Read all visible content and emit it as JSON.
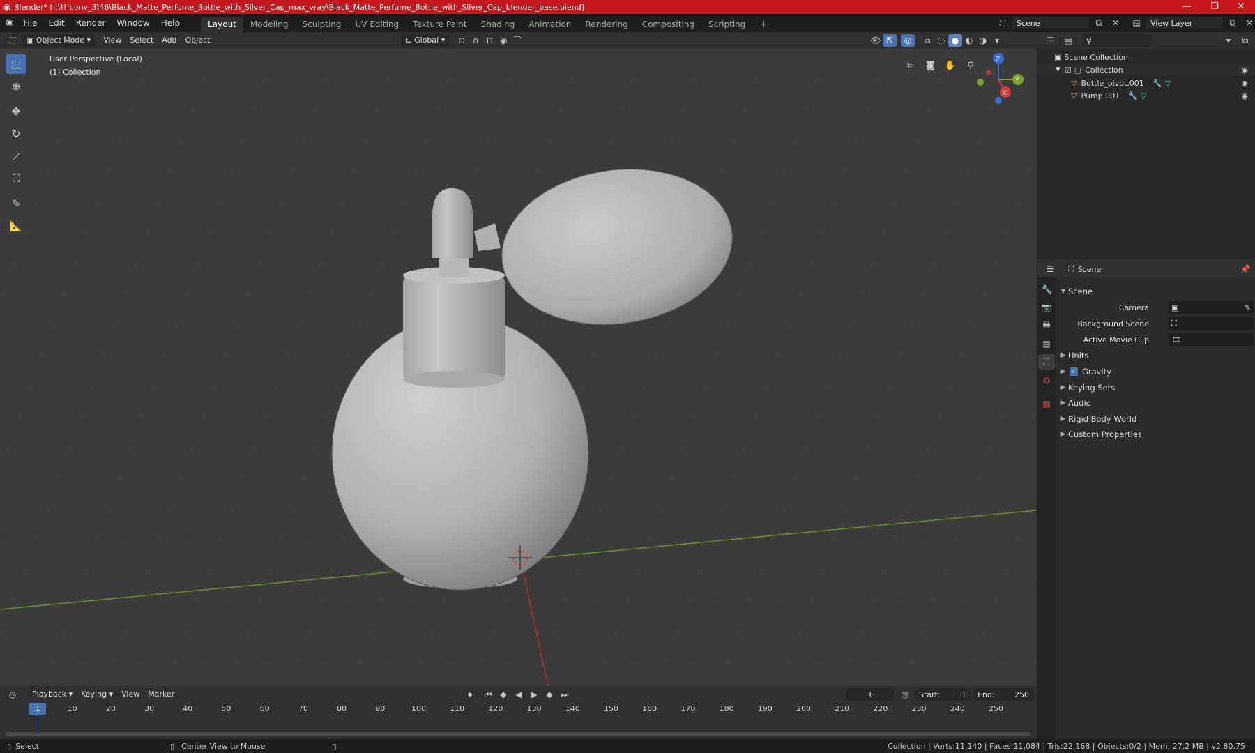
{
  "window": {
    "title": "Blender* [I:\\!!!conv_3\\46\\Black_Matte_Perfume_Bottle_with_Silver_Cap_max_vray\\Black_Matte_Perfume_Bottle_with_Silver_Cap_blender_base.blend]",
    "accent": "#c4161c"
  },
  "menu": [
    "File",
    "Edit",
    "Render",
    "Window",
    "Help"
  ],
  "workspaces": [
    "Layout",
    "Modeling",
    "Sculpting",
    "UV Editing",
    "Texture Paint",
    "Shading",
    "Animation",
    "Rendering",
    "Compositing",
    "Scripting"
  ],
  "active_workspace": "Layout",
  "scene_selector": "Scene",
  "view_layer_selector": "View Layer",
  "viewport_header": {
    "mode": "Object Mode",
    "menus": [
      "View",
      "Select",
      "Add",
      "Object"
    ],
    "orientation": "Global"
  },
  "viewport": {
    "perspective_label": "User Perspective (Local)",
    "collection_label": "(1) Collection",
    "gizmo": {
      "z": "Z",
      "y": "Y",
      "x": "X"
    }
  },
  "outliner": {
    "root": "Scene Collection",
    "collection": "Collection",
    "objects": [
      "Bottle_pivot.001",
      "Pump.001"
    ]
  },
  "properties": {
    "header": "Scene",
    "panel": "Scene",
    "fields": [
      {
        "label": "Camera"
      },
      {
        "label": "Background Scene"
      },
      {
        "label": "Active Movie Clip"
      }
    ],
    "sections": [
      "Units",
      "Gravity",
      "Keying Sets",
      "Audio",
      "Rigid Body World",
      "Custom Properties"
    ],
    "gravity_checked": true
  },
  "timeline": {
    "menus": [
      "Playback",
      "Keying",
      "View",
      "Marker"
    ],
    "current_frame": "1",
    "start_label": "Start:",
    "start": "1",
    "end_label": "End:",
    "end": "250",
    "ticks": [
      "1",
      "10",
      "20",
      "30",
      "40",
      "50",
      "60",
      "70",
      "80",
      "90",
      "100",
      "110",
      "120",
      "130",
      "140",
      "150",
      "160",
      "170",
      "180",
      "190",
      "200",
      "210",
      "220",
      "230",
      "240",
      "250"
    ]
  },
  "status": {
    "left": "Select",
    "middle": "Center View to Mouse",
    "right": "Collection | Verts:11,140 | Faces:11,084 | Tris:22,168 | Objects:0/2 | Mem: 27.2 MB | v2.80.75"
  }
}
